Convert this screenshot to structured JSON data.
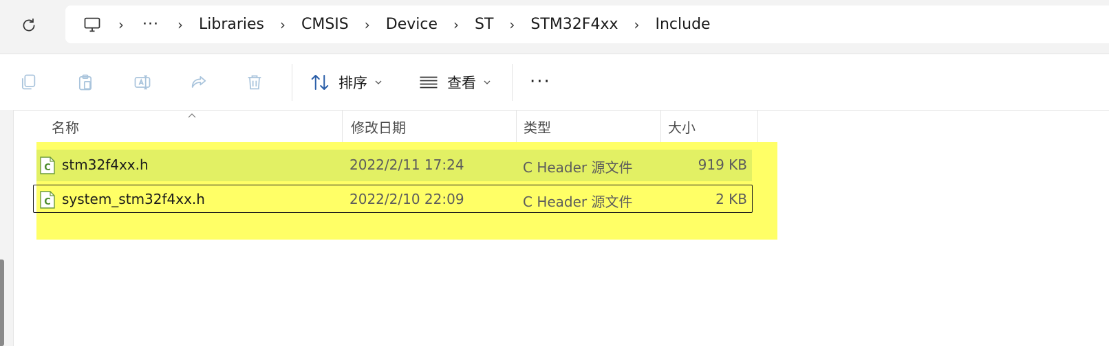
{
  "breadcrumb": {
    "overflow": "···",
    "items": [
      "Libraries",
      "CMSIS",
      "Device",
      "ST",
      "STM32F4xx",
      "Include"
    ]
  },
  "toolbar": {
    "sort_label": "排序",
    "view_label": "查看",
    "more_label": "···"
  },
  "columns": [
    "名称",
    "修改日期",
    "类型",
    "大小"
  ],
  "files": [
    {
      "name": "stm32f4xx.h",
      "modified": "2022/2/11 17:24",
      "type": "C Header 源文件",
      "size": "919 KB",
      "icon_letter": "C"
    },
    {
      "name": "system_stm32f4xx.h",
      "modified": "2022/2/10 22:09",
      "type": "C Header 源文件",
      "size": "2 KB",
      "icon_letter": "C"
    }
  ],
  "colors": {
    "highlight": "#ffff66",
    "selected_row": "#e2f064",
    "file_icon": "#4a8a2a"
  }
}
